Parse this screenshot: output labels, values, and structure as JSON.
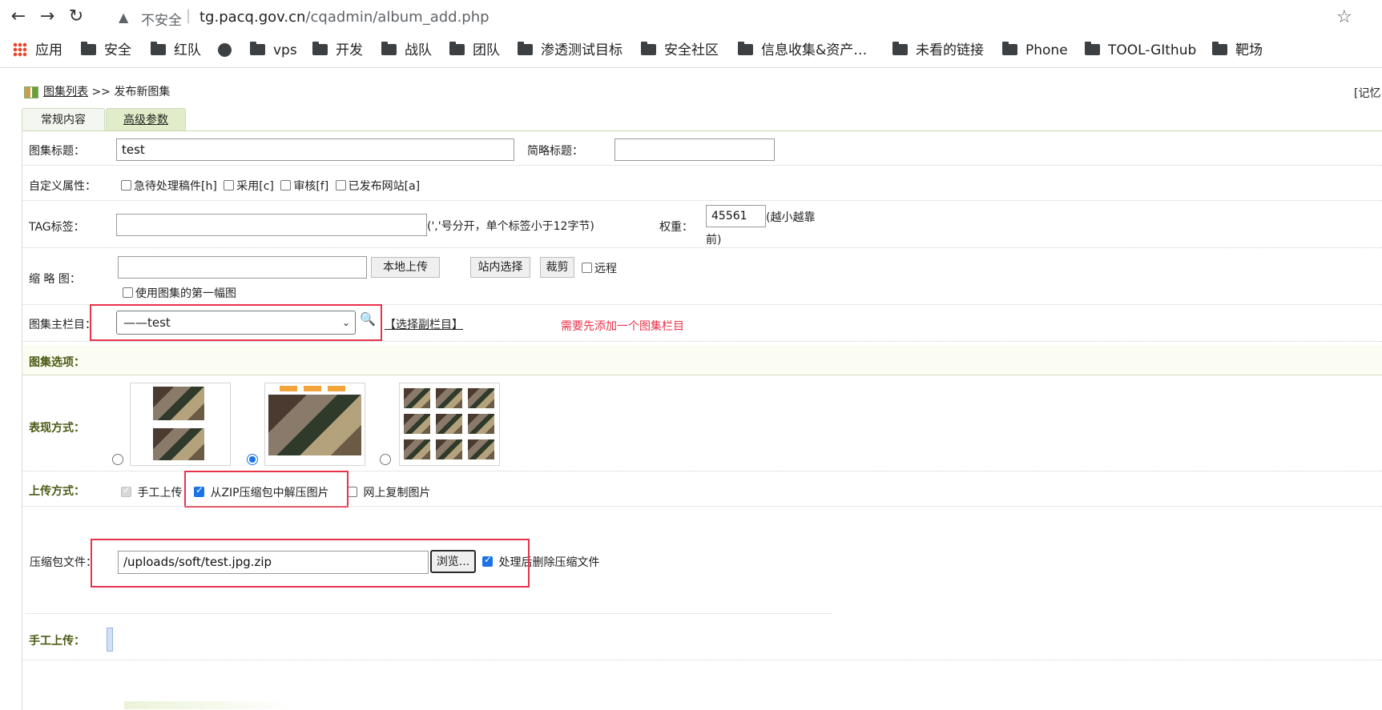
{
  "browser": {
    "url_warning": "不安全",
    "url_host": "tg.pacq.gov.cn",
    "url_path": "/cqadmin/album_add.php",
    "bookmarks": [
      "应用",
      "安全",
      "红队",
      "",
      "vps",
      "开发",
      "战队",
      "团队",
      "渗透测试目标",
      "安全社区",
      "信息收集&资产…",
      "未看的链接",
      "Phone",
      "TOOL-GIthub",
      "靶场"
    ]
  },
  "page": {
    "breadcrumb_link": "图集列表",
    "breadcrumb_sep": ">>",
    "breadcrumb_current": "发布新图集",
    "memo_link": "[记忆",
    "tabs": [
      "常规内容",
      "高级参数"
    ]
  },
  "form": {
    "title_label": "图集标题：",
    "title_value": "test",
    "short_title_label": "简略标题：",
    "short_title_value": "",
    "attr_label": "自定义属性：",
    "attrs": [
      "急待处理稿件[h]",
      "采用[c]",
      "审核[f]",
      "已发布网站[a]"
    ],
    "tag_label": "TAG标签：",
    "tag_value": "",
    "tag_hint": "(','号分开，单个标签小于12字节)",
    "weight_label": "权重：",
    "weight_value": "45561",
    "weight_hint": "(越小越靠",
    "weight_hint2": "前)",
    "thumb_label": "缩 略 图：",
    "thumb_value": "",
    "upload_local": "本地上传",
    "site_select": "站内选择",
    "crop": "裁剪",
    "remote": "远程",
    "use_first": "使用图集的第一幅图",
    "category_label": "图集主栏目：",
    "category_value": "——test",
    "sub_category": "【选择副栏目】",
    "category_note": "需要先添加一个图集栏目",
    "options_header": "图集选项：",
    "display_label": "表现方式：",
    "display_selected_index": 1,
    "upload_mode_label": "上传方式：",
    "upload_modes": [
      "手工上传",
      "从ZIP压缩包中解压图片",
      "网上复制图片"
    ],
    "zip_label": "压缩包文件：",
    "zip_value": "/uploads/soft/test.jpg.zip",
    "browse": "浏览...",
    "delete_after": "处理后删除压缩文件",
    "manual_label": "手工上传："
  },
  "colors": {
    "accent_red": "#e8334a",
    "label_green": "#4a5a14",
    "tab_active": "#e1edc8"
  }
}
